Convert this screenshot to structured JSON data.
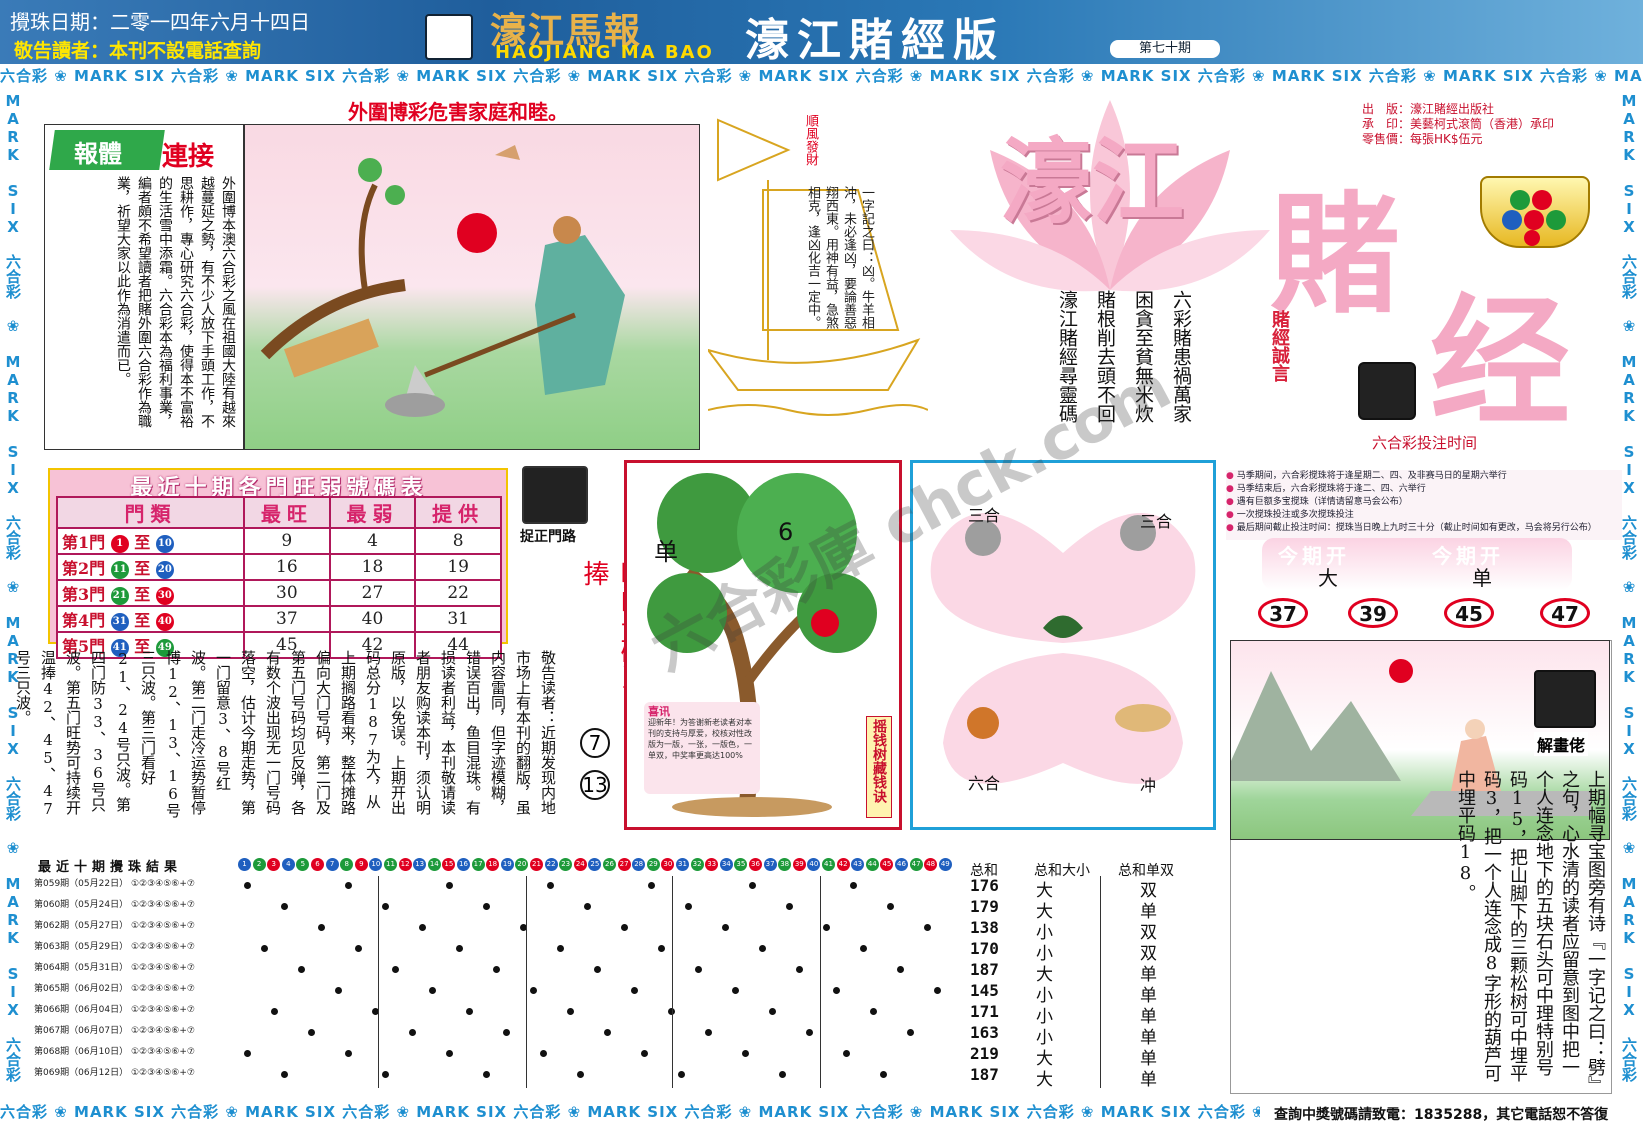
{
  "header": {
    "draw_date": "攪珠日期：二零一四年六月十四日",
    "notice": "敬告讀者：本刊不設電話查詢",
    "logo_cn": "濠江馬報",
    "logo_en": "HAOJIANG MA BAO",
    "edition": "濠江賭經版",
    "issue": "第七十期"
  },
  "ticker_text": "六合彩 ❀ MARK SIX 六合彩 ❀ MARK SIX 六合彩 ❀ MARK SIX 六合彩 ❀ MARK SIX 六合彩 ❀ MARK SIX 六合彩 ❀ MARK SIX 六合彩 ❀ MARK SIX 六合彩 ❀ MARK SIX 六合彩 ❀ MARK SIX 六合彩 ❀ MARK SIX",
  "vertical_ticker": "MARK SIX 六合彩 ❀ MARK SIX 六合彩 ❀ MARK SIX 六合彩 ❀ MARK SIX 六合彩 ❀ MARK SIX 六合彩 ❀ MARK SIX 六合彩 ❀ MARK SIX 六合彩",
  "warning": "外圍博彩危害家庭和睦。",
  "story": {
    "badge": "報體",
    "title": "連接",
    "text": "外圍博本澳六合彩之風在祖國大陸有越來越蔓延之勢，有不少人放下手頭工作，不思耕作，專心研究六合彩，使得本不富裕的生活雪中添霜。六合彩本為福利事業，編者頗不希望讀者把賭外圍六合彩作為職業，祈望大家以此作為消遣而已。"
  },
  "boat": {
    "flag": "順風發財",
    "poem": "一字記之曰：凶。牛羊相沖，未必逢凶，要論善惡翔西東。用神有益，急煞相克，逢凶化吉一定中。"
  },
  "proverbs": [
    "六彩賭患禍萬家",
    "困貪至貧無米炊",
    "賭根削去頭不回",
    "濠江賭經尋靈碼"
  ],
  "title": {
    "hao": "濠江",
    "du": "賭",
    "jing": "经",
    "motto": "賭經誠言"
  },
  "publish": [
    "出　版：濠江賭經出版社",
    "承　印：美藝柯式滾筒（香港）承印",
    "零售價：每張HK$伍元"
  ],
  "bet": {
    "title": "六合彩投注时间",
    "rules": [
      "马季期间，六合彩搅珠将于逢星期二、四、及非赛马日的星期六举行",
      "马季结束后，六合彩搅珠将于逢二、四、六举行",
      "遇有巨额多宝搅珠（详情请留意马会公布）",
      "一次搅珠投注或多次搅珠投注",
      "最后期间截止投注时间：搅珠当日晚上九时三十分（截止时间如有更改，马会将另行公布）"
    ],
    "open_label": "今期开",
    "open_values": [
      "大",
      "单"
    ],
    "result_numbers": [
      "37",
      "39",
      "45",
      "47"
    ]
  },
  "hot_table": {
    "title": "最近十期各門旺弱號碼表",
    "headers": [
      "門類",
      "最旺",
      "最弱",
      "提供"
    ],
    "rows": [
      {
        "door": "第1門",
        "from": "1",
        "to": "10",
        "fc": "mb-r",
        "tc": "mb-b",
        "hot": "9",
        "cold": "4",
        "tip": "8"
      },
      {
        "door": "第2門",
        "from": "11",
        "to": "20",
        "fc": "mb-g",
        "tc": "mb-b",
        "hot": "16",
        "cold": "18",
        "tip": "19"
      },
      {
        "door": "第3門",
        "from": "21",
        "to": "30",
        "fc": "mb-g",
        "tc": "mb-r",
        "hot": "30",
        "cold": "27",
        "tip": "22"
      },
      {
        "door": "第4門",
        "from": "31",
        "to": "40",
        "fc": "mb-b",
        "tc": "mb-r",
        "hot": "37",
        "cold": "40",
        "tip": "31"
      },
      {
        "door": "第5門",
        "from": "41",
        "to": "49",
        "fc": "mb-b",
        "tc": "mb-g",
        "hot": "45",
        "cold": "42",
        "tip": "44"
      }
    ],
    "to_word": "至"
  },
  "road": {
    "title": "捉正門路",
    "hot_door": "旺门号码当捧",
    "hot_balls": [
      "7",
      "13"
    ],
    "analysis": "敬告读者：近期发现内地市场上有本刊的翻版，虽内容雷同，但字迹模糊，错误百出，鱼目混珠。有损读者利益，本刊敬请读者朋友购读本刊，须认明原版，以免误。上期开出码总分187为大，从上期搁路看来，整体摊路偏向大门号码，第二门及第五门号码均见反弹，各有数个波出现无一门号码落空，估计今期走势，第一门留意3、8号红波。第二门走冷运势暂停博12、13、16号三只波。第三门看好21、24号只波。第四门防33、36号只波。第五门旺势可持续开温捧42、45、47号三只波。"
  },
  "tree": {
    "label_dan": "单",
    "label_num": "6",
    "side_text": "摇钱树藏钱诀",
    "note_head": "喜讯",
    "note": "迎新年！为答谢新老读者对本刊的支持与厚爱，校核对性改版为一版，一张，一版色，一单双，中奖率更高达100%"
  },
  "zodiac": {
    "labels": [
      "三合",
      "三合",
      "六合",
      "冲"
    ]
  },
  "solution": {
    "title": "解畫佬",
    "text": "上期幅寻宝图旁有诗『一字记之曰：劈』之句，心水清的读者应留意到图中把一个人连念地下的五块石头可中理特别号码15，把山脚下的三颗松树可中埋平码3，把一个人连念成8字形的葫芦可中埋平码18。"
  },
  "results": {
    "header": "最近十期攪珠結果",
    "stats_headers": [
      "总和",
      "总和大小",
      "总和单双"
    ],
    "rows": [
      {
        "issue": "第059期（05月22日）",
        "nums": "①②③④⑤⑥+⑦",
        "sum": "176",
        "bs": "大",
        "oe": "双"
      },
      {
        "issue": "第060期（05月24日）",
        "nums": "①②③④⑤⑥+⑦",
        "sum": "179",
        "bs": "大",
        "oe": "单"
      },
      {
        "issue": "第062期（05月27日）",
        "nums": "①②③④⑤⑥+⑦",
        "sum": "138",
        "bs": "小",
        "oe": "双"
      },
      {
        "issue": "第063期（05月29日）",
        "nums": "①②③④⑤⑥+⑦",
        "sum": "170",
        "bs": "小",
        "oe": "双"
      },
      {
        "issue": "第064期（05月31日）",
        "nums": "①②③④⑤⑥+⑦",
        "sum": "187",
        "bs": "大",
        "oe": "单"
      },
      {
        "issue": "第065期（06月02日）",
        "nums": "①②③④⑤⑥+⑦",
        "sum": "145",
        "bs": "小",
        "oe": "单"
      },
      {
        "issue": "第066期（06月04日）",
        "nums": "①②③④⑤⑥+⑦",
        "sum": "171",
        "bs": "小",
        "oe": "单"
      },
      {
        "issue": "第067期（06月07日）",
        "nums": "①②③④⑤⑥+⑦",
        "sum": "163",
        "bs": "小",
        "oe": "单"
      },
      {
        "issue": "第068期（06月10日）",
        "nums": "①②③④⑤⑥+⑦",
        "sum": "219",
        "bs": "大",
        "oe": "单"
      },
      {
        "issue": "第069期（06月12日）",
        "nums": "①②③④⑤⑥+⑦",
        "sum": "187",
        "bs": "大",
        "oe": "单"
      }
    ]
  },
  "hotline": "查詢中獎號碼請致電：1835288，其它電話恕不答復",
  "watermark": "六合彩庫 chck.com",
  "colors": {
    "brand_blue": "#1f5e9c",
    "accent_red": "#e00020",
    "pink": "#f4a9c4",
    "ticker_blue": "#1e8fd0"
  }
}
